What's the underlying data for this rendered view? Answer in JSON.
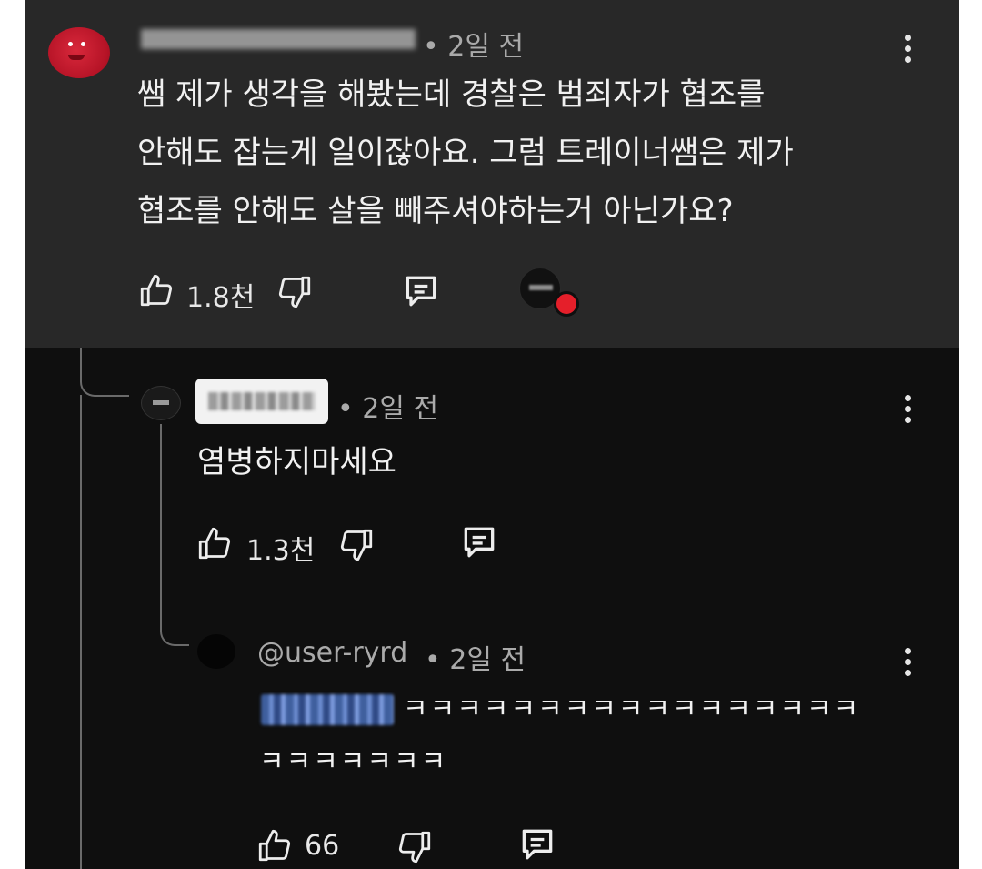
{
  "comment": {
    "time": "• 2일 전",
    "lines": [
      "쌤 제가 생각을 해봤는데 경찰은 범죄자가 협조를",
      "안해도 잡는게 일이잖아요. 그럼 트레이너쌤은 제가",
      "협조를 안해도 살을 빼주셔야하는거 아닌가요?"
    ],
    "likes": "1.8천"
  },
  "reply": {
    "time": "• 2일 전",
    "text": "염병하지마세요",
    "likes": "1.3천"
  },
  "nested_reply": {
    "author": "@user-ryrd",
    "time": "• 2일 전",
    "line1": "ㅋㅋㅋㅋㅋㅋㅋㅋㅋㅋㅋㅋㅋㅋㅋㅋㅋ",
    "line2": "ㅋㅋㅋㅋㅋㅋㅋ",
    "likes": "66"
  },
  "icons": {
    "like": "thumbs-up-icon",
    "dislike": "thumbs-down-icon",
    "reply": "reply-comment-icon",
    "more": "kebab-menu-icon"
  },
  "colors": {
    "background": "#0f0f0f",
    "highlighted_comment_bg": "#282828",
    "text": "#f1f1f1",
    "meta_text": "#aaaaaa",
    "creator_heart": "#e51f2a"
  }
}
